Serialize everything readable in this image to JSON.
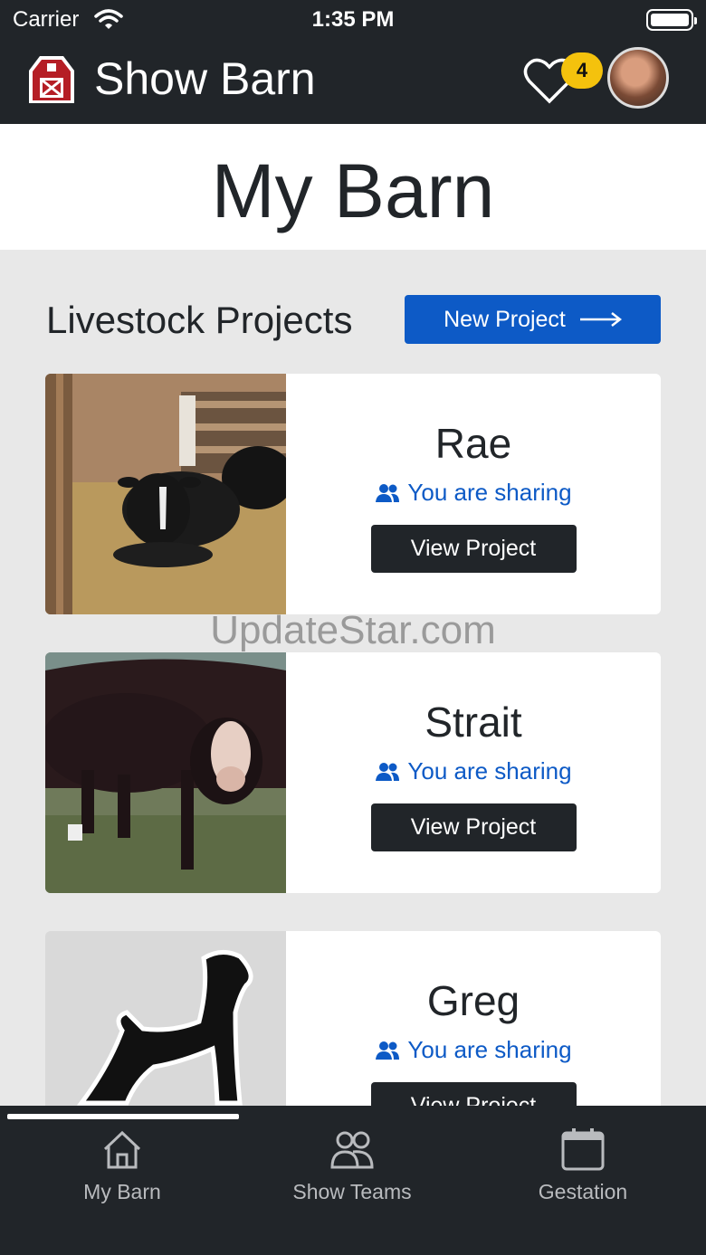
{
  "status_bar": {
    "carrier": "Carrier",
    "time": "1:35 PM"
  },
  "app_bar": {
    "title": "Show Barn",
    "notification_count": "4"
  },
  "page": {
    "title": "My Barn"
  },
  "section": {
    "title": "Livestock Projects",
    "new_project_label": "New Project"
  },
  "projects": [
    {
      "name": "Rae",
      "sharing_label": "You are sharing",
      "button_label": "View Project"
    },
    {
      "name": "Strait",
      "sharing_label": "You are sharing",
      "button_label": "View Project"
    },
    {
      "name": "Greg",
      "sharing_label": "You are sharing",
      "button_label": "View Project"
    }
  ],
  "watermark": "UpdateStar.com",
  "tabs": [
    {
      "label": "My Barn",
      "icon": "home-icon",
      "active": true
    },
    {
      "label": "Show Teams",
      "icon": "people-icon",
      "active": false
    },
    {
      "label": "Gestation",
      "icon": "calendar-icon",
      "active": false
    }
  ],
  "colors": {
    "dark": "#212529",
    "accent": "#0d5ac6",
    "badge": "#f4c20d"
  }
}
